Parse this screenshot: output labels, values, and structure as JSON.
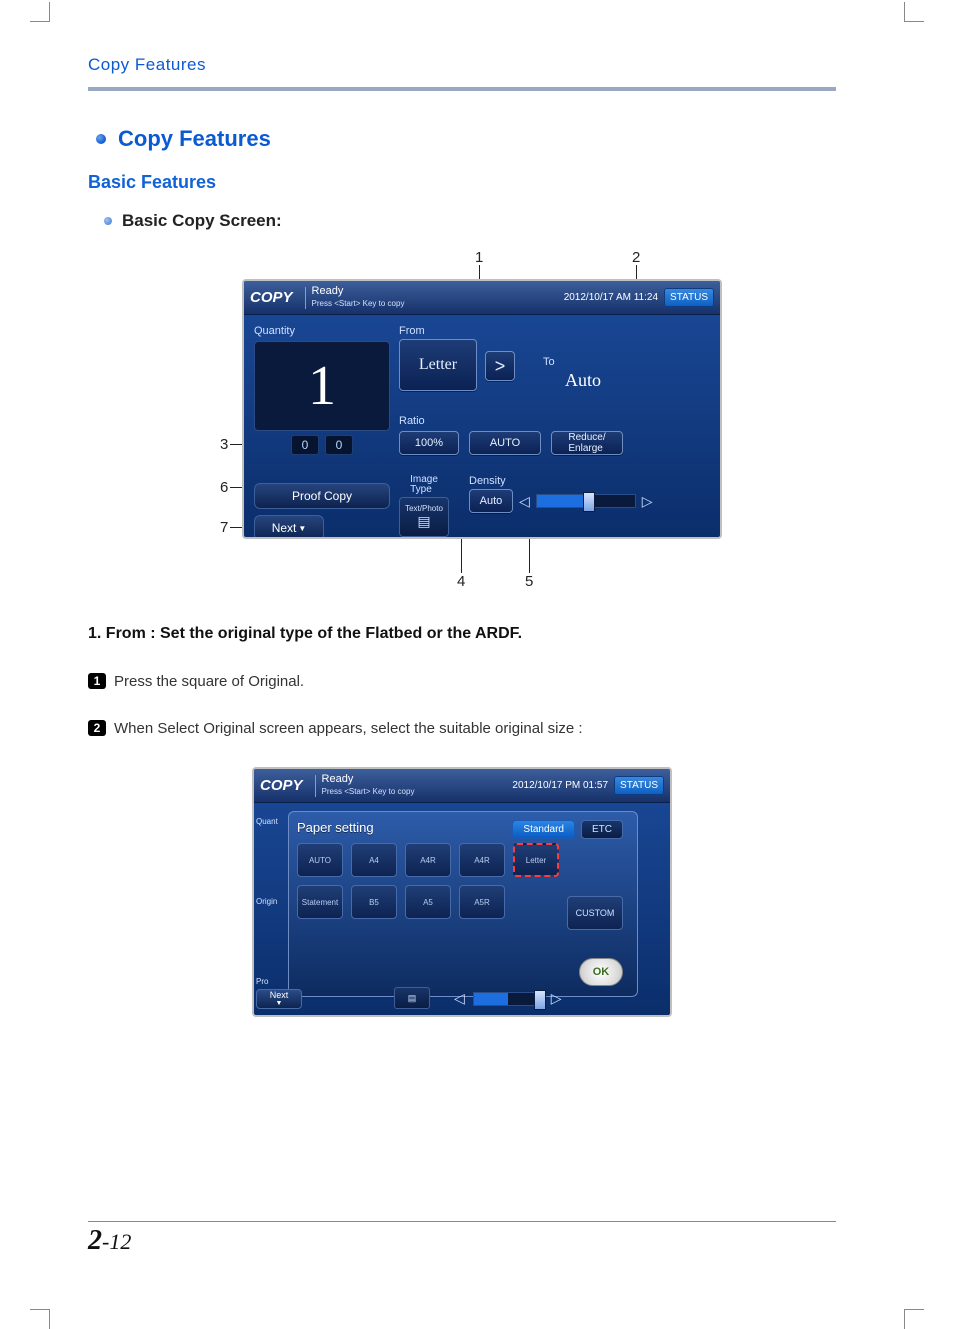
{
  "page": {
    "header": "Copy Features",
    "section_title": "Copy Features",
    "sub_heading": "Basic Features",
    "sub_item": "Basic Copy Screen:",
    "page_number_chapter": "2",
    "page_number_page": "-12"
  },
  "figure1_callouts": {
    "1": "1",
    "2": "2",
    "3": "3",
    "4": "4",
    "5": "5",
    "6": "6",
    "7": "7"
  },
  "panel1": {
    "title": "COPY",
    "ready": "Ready",
    "hint": "Press <Start> Key to copy",
    "datetime": "2012/10/17 AM 11:24",
    "status_btn": "STATUS",
    "quantity_label": "Quantity",
    "quantity_value": "1",
    "mini1": "0",
    "mini2": "0",
    "from_label": "From",
    "from_value": "Letter",
    "arrow": ">",
    "to_label": "To",
    "to_value": "Auto",
    "ratio_label": "Ratio",
    "ratio_value": "100%",
    "auto_btn": "AUTO",
    "reduce_btn": "Reduce/\nEnlarge",
    "proof_btn": "Proof Copy",
    "next_btn": "Next",
    "image_type_label": "Image\nType",
    "image_type_sub": "Text/Photo",
    "density_label": "Density",
    "density_auto": "Auto"
  },
  "body": {
    "h1": "1.  From : Set the original type of the Flatbed  or the ARDF.",
    "step1_num": "1",
    "step1": "Press the square of Original.",
    "step2_num": "2",
    "step2": "When Select Original screen appears, select the suitable original size :"
  },
  "panel2": {
    "title": "COPY",
    "ready": "Ready",
    "hint": "Press <Start> Key to copy",
    "datetime": "2012/10/17 PM 01:57",
    "status_btn": "STATUS",
    "dialog_title": "Paper setting",
    "tab_standard": "Standard",
    "tab_etc": "ETC",
    "sizes": [
      "AUTO",
      "A4",
      "A4R",
      "A4R",
      "Letter",
      "Statement",
      "B5",
      "A5",
      "A5R"
    ],
    "selected_index": 4,
    "custom": "CUSTOM",
    "ok": "OK",
    "left_quant": "Quant",
    "left_origin": "Origin",
    "left_pro": "Pro",
    "next": "Next"
  }
}
